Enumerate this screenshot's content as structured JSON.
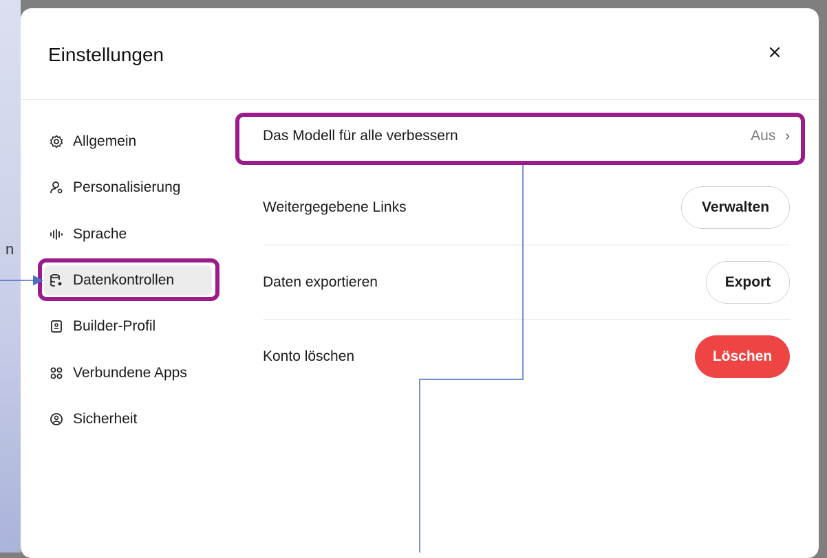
{
  "background": {
    "fragment_text": "n"
  },
  "modal": {
    "title": "Einstellungen",
    "close_icon": "close-icon"
  },
  "sidebar": {
    "items": [
      {
        "label": "Allgemein",
        "icon": "gear-icon"
      },
      {
        "label": "Personalisierung",
        "icon": "person-settings-icon"
      },
      {
        "label": "Sprache",
        "icon": "waveform-icon"
      },
      {
        "label": "Datenkontrollen",
        "icon": "database-settings-icon",
        "active": true
      },
      {
        "label": "Builder-Profil",
        "icon": "id-card-icon"
      },
      {
        "label": "Verbundene Apps",
        "icon": "apps-grid-icon"
      },
      {
        "label": "Sicherheit",
        "icon": "shield-user-icon"
      }
    ]
  },
  "settings": {
    "improve_model": {
      "label": "Das Modell für alle verbessern",
      "value": "Aus",
      "chevron": "›"
    },
    "shared_links": {
      "label": "Weitergegebene Links",
      "button": "Verwalten"
    },
    "export_data": {
      "label": "Daten exportieren",
      "button": "Export"
    },
    "delete_account": {
      "label": "Konto löschen",
      "button": "Löschen"
    }
  },
  "colors": {
    "highlight": "#9b1b8a",
    "connector": "#4a6fc4",
    "danger": "#ef4444",
    "active_bg": "#ececec"
  }
}
